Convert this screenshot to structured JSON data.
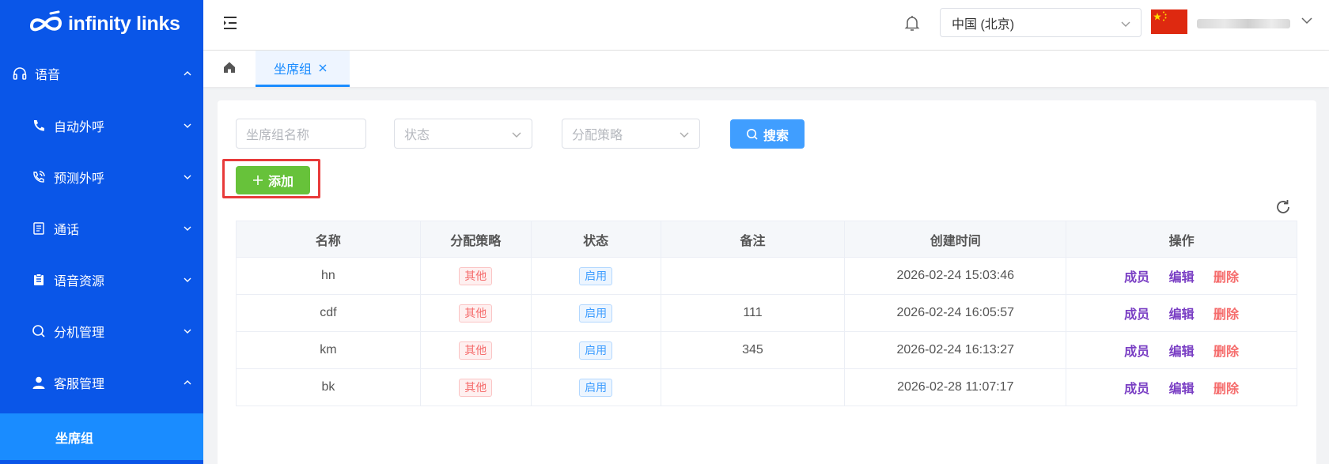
{
  "brand": {
    "name": "infinity links"
  },
  "sidebar": {
    "items": [
      {
        "label": "语音",
        "level": "top",
        "icon": "headset-icon",
        "expanded": true
      },
      {
        "label": "自动外呼",
        "level": "sub",
        "icon": "phone-icon",
        "expanded": false
      },
      {
        "label": "预测外呼",
        "level": "sub",
        "icon": "phone-ringing-icon",
        "expanded": false
      },
      {
        "label": "通话",
        "level": "sub",
        "icon": "document-icon",
        "expanded": false
      },
      {
        "label": "语音资源",
        "level": "sub",
        "icon": "clipboard-icon",
        "expanded": false
      },
      {
        "label": "分机管理",
        "level": "sub",
        "icon": "search-icon",
        "expanded": false
      },
      {
        "label": "客服管理",
        "level": "sub",
        "icon": "user-icon",
        "expanded": true
      }
    ],
    "active_item": "坐席组"
  },
  "header": {
    "region": "中国 (北京)",
    "colors": {
      "flag": "#de2910"
    }
  },
  "tabs": {
    "active_label": "坐席组"
  },
  "filters": {
    "name_placeholder": "坐席组名称",
    "status_placeholder": "状态",
    "strategy_placeholder": "分配策略",
    "search_label": "搜索"
  },
  "toolbar": {
    "add_label": "添加"
  },
  "table": {
    "columns": [
      "名称",
      "分配策略",
      "状态",
      "备注",
      "创建时间",
      "操作"
    ],
    "rows": [
      {
        "name": "hn",
        "strategy": "其他",
        "status": "启用",
        "remark": "",
        "created": "2026-02-24 15:03:46"
      },
      {
        "name": "cdf",
        "strategy": "其他",
        "status": "启用",
        "remark": "111",
        "created": "2026-02-24 16:05:57"
      },
      {
        "name": "km",
        "strategy": "其他",
        "status": "启用",
        "remark": "345",
        "created": "2026-02-24 16:13:27"
      },
      {
        "name": "bk",
        "strategy": "其他",
        "status": "启用",
        "remark": "",
        "created": "2026-02-28 11:07:17"
      }
    ],
    "actions": {
      "member": "成员",
      "edit": "编辑",
      "delete": "删除"
    }
  },
  "colors": {
    "sidebar_bg": "#0a56e8",
    "sidebar_active": "#1a8cff",
    "primary": "#409eff",
    "success": "#67c23a",
    "danger": "#f56c6c",
    "highlight_border": "#e83a3a"
  }
}
